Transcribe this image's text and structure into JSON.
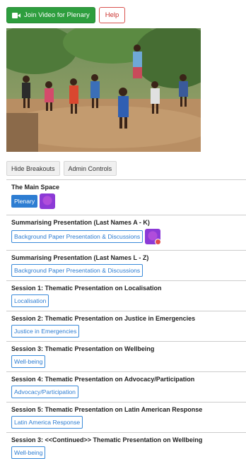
{
  "toolbar": {
    "join_label": "Join Video for Plenary",
    "help_label": "Help",
    "join_color": "#2e9e3e",
    "help_color": "#d9534f"
  },
  "admin": {
    "hide_breakouts_label": "Hide Breakouts",
    "admin_controls_label": "Admin Controls"
  },
  "rooms": [
    {
      "title": "The Main Space",
      "link": "Plenary"
    },
    {
      "title": "Summarising Presentation (Last Names A - K)",
      "link": "Background Paper Presentation & Discussions"
    },
    {
      "title": "Summarising Presentation (Last Names L - Z)",
      "link": "Background Paper Presentation & Discussions"
    },
    {
      "title": "Session 1: Thematic Presentation on Localisation",
      "link": "Localisation"
    },
    {
      "title": "Session 2: Thematic Presentation on Justice in Emergencies",
      "link": "Justice in Emergencies"
    },
    {
      "title": "Session 3: Thematic Presentation on Wellbeing",
      "link": "Well-being"
    },
    {
      "title": "Session 4: Thematic Presentation on Advocacy/Participation",
      "link": "Advocacy/Participation"
    },
    {
      "title": "Session 5: Thematic Presentation on Latin American Response",
      "link": "Latin America Response"
    },
    {
      "title": "Session 3: <<Continued>> Thematic Presentation on Wellbeing",
      "link": "Well-being"
    }
  ],
  "accent_color": "#2d7dd2"
}
